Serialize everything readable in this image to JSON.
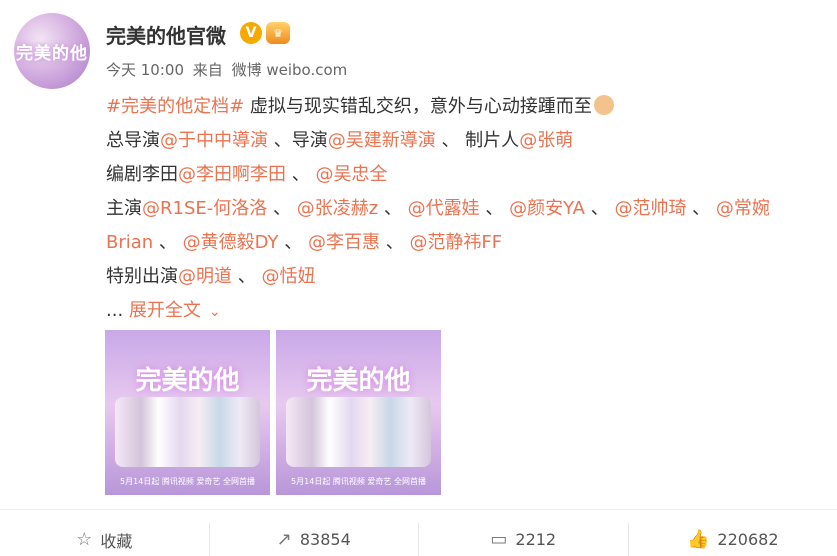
{
  "account": {
    "name": "完美的他官微",
    "avatar_text": "完美的他"
  },
  "meta": {
    "time": "今天 10:00",
    "from": "来自",
    "source": "微博 weibo.com"
  },
  "post": {
    "line1": {
      "hashtag": "#完美的他定档#",
      "text": " 虚拟与现实错乱交织，意外与心动接踵而至"
    },
    "line2": {
      "prefix1": "总导演",
      "at1": "@于中中導演",
      "sep1": " 、导演",
      "at2": "@吴建新導演",
      "sep2": " 、 制片人",
      "at3": "@张萌"
    },
    "line3": {
      "prefix": "编剧李田",
      "at1": "@李田啊李田",
      "sep1": " 、 ",
      "at2": "@吴忠全"
    },
    "line4": {
      "prefix": "主演",
      "at1": "@R1SE-何洛洛",
      "sep1": " 、 ",
      "at2": "@张凌赫z",
      "sep2": " 、 ",
      "at3": "@代露娃",
      "sep3": " 、 ",
      "at4": "@颜安YA",
      "sep4": " 、 ",
      "at5": "@范帅琦",
      "sep5": " 、 ",
      "at6": "@常婉"
    },
    "line5": {
      "at0": "Brian",
      "sep0": " 、 ",
      "at1": "@黄德毅DY",
      "sep1": " 、 ",
      "at2": "@李百惠",
      "sep2": " 、 ",
      "at3": "@范静祎FF"
    },
    "line6": {
      "prefix": "特别出演",
      "at1": "@明道",
      "sep1": " 、 ",
      "at2": "@恬妞"
    },
    "line7": {
      "ellipsis": "...",
      "expand": "展开全文"
    }
  },
  "images": [
    {
      "title": "完美的他",
      "credits": "5月14日起 腾讯视频 爱奇艺 全网首播"
    },
    {
      "title": "完美的他",
      "credits": "5月14日起 腾讯视频 爱奇艺 全网首播"
    }
  ],
  "toolbar": {
    "favorite": "收藏",
    "share_count": "83854",
    "comment_count": "2212",
    "like_count": "220682"
  },
  "colors": {
    "accent": "#eb7350",
    "verified": "#f6a900",
    "text": "#333333"
  },
  "icons": {
    "favorite": "star-icon",
    "share": "share-icon",
    "comment": "comment-icon",
    "like": "thumb-up-icon"
  }
}
